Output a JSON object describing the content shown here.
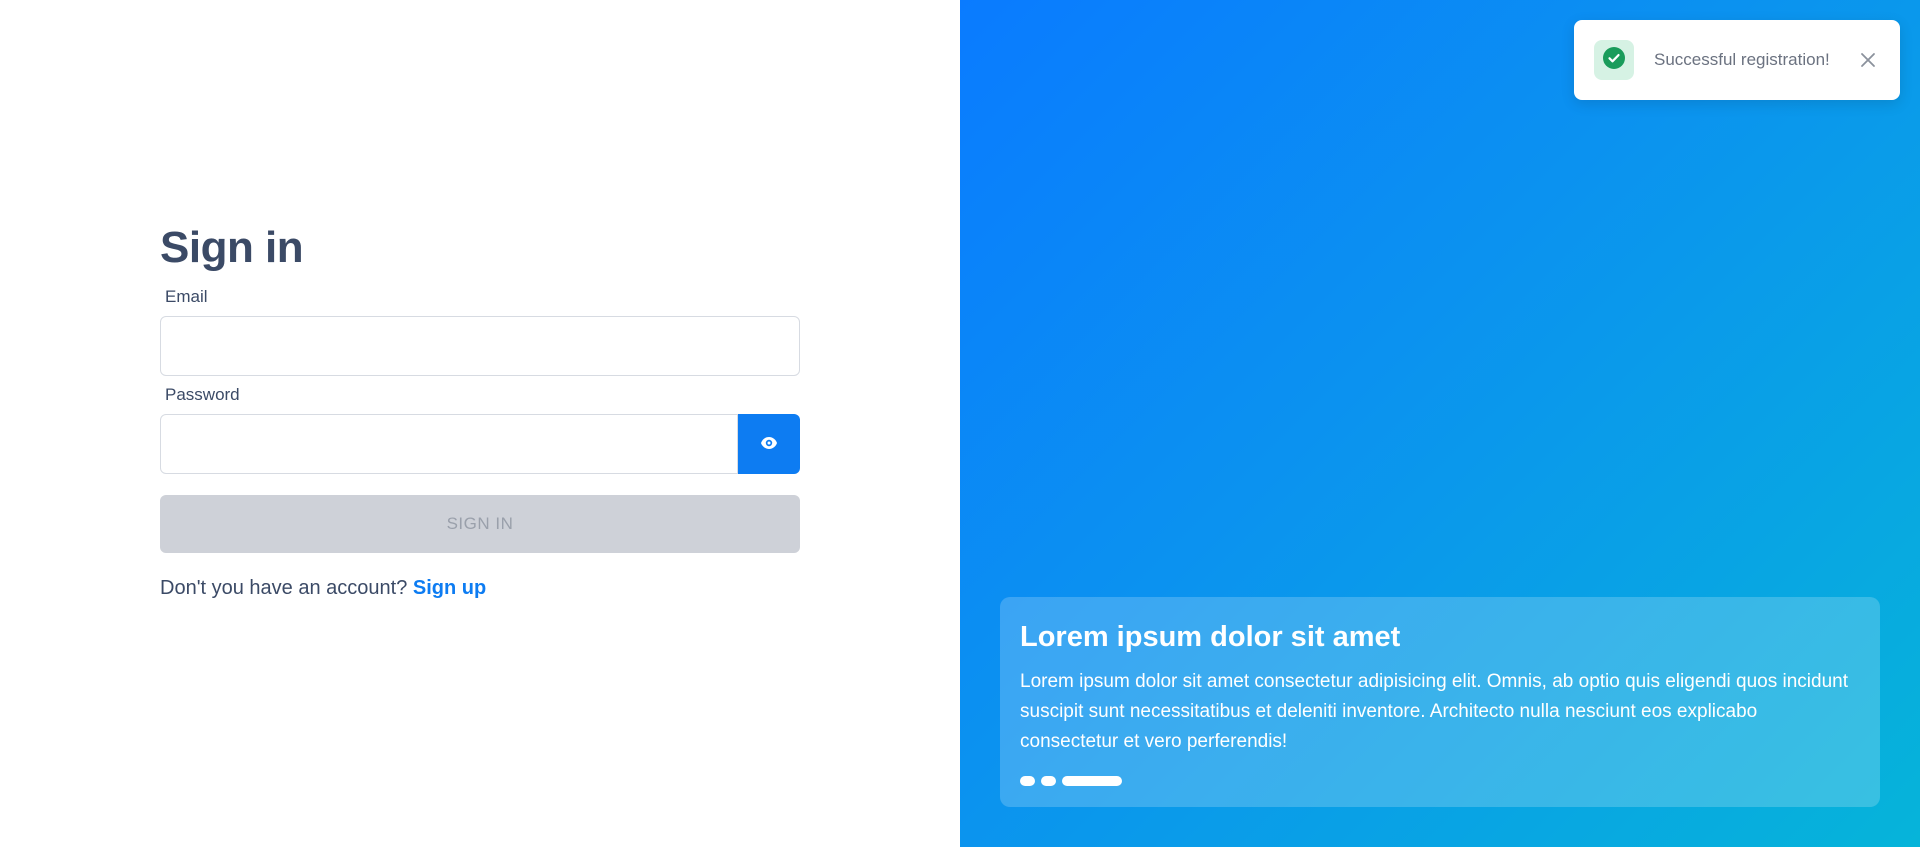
{
  "signin": {
    "title": "Sign in",
    "email_label": "Email",
    "email_value": "",
    "password_label": "Password",
    "password_value": "",
    "submit_label": "SIGN IN",
    "no_account_text": "Don't you have an account?",
    "signup_link": "Sign up"
  },
  "promo": {
    "title": "Lorem ipsum dolor sit amet",
    "body": "Lorem ipsum dolor sit amet consectetur adipisicing elit. Omnis, ab optio quis eligendi quos incidunt suscipit sunt necessitatibus et deleniti inventore. Architecto nulla nesciunt eos explicabo consectetur et vero perferendis!",
    "slides": 3,
    "active_slide": 3
  },
  "toast": {
    "message": "Successful registration!",
    "icon": "check-circle-icon",
    "close_icon": "close-icon"
  },
  "colors": {
    "accent": "#0d7cf2",
    "title_text": "#3b4a66",
    "disabled_button": "#ced1d8",
    "success": "#1a9c5b",
    "gradient_start": "#0a7bff",
    "gradient_end": "#06b4d9"
  }
}
